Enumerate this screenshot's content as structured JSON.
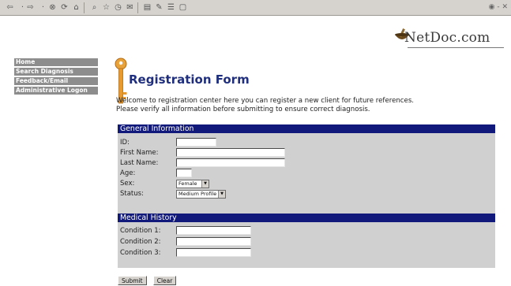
{
  "toolbar": {
    "buttons": [
      "back-icon",
      "forward-icon",
      "stop-icon",
      "refresh-icon",
      "home-icon",
      "search-icon",
      "favorites-icon",
      "history-icon",
      "mail-icon",
      "print-icon",
      "edit-icon",
      "discuss-icon",
      "messenger-icon"
    ]
  },
  "logo": {
    "text": "NetDoc.com"
  },
  "sidebar": {
    "items": [
      {
        "label": "Home"
      },
      {
        "label": "Search Diagnosis"
      },
      {
        "label": "Feedback/Email"
      },
      {
        "label": "Administrative Logon"
      }
    ]
  },
  "page": {
    "title": "Registration Form",
    "intro_line1": "Welcome to registration center here you can register a new client for future references.",
    "intro_line2": "Please verify all information  before submitting to ensure correct diagnosis."
  },
  "general": {
    "header": "General Information",
    "id_label": "ID:",
    "first_name_label": "First Name:",
    "last_name_label": "Last Name:",
    "age_label": "Age:",
    "sex_label": "Sex:",
    "sex_value": "Female",
    "status_label": "Status:",
    "status_value": "Medium Profile"
  },
  "medical": {
    "header": "Medical History",
    "condition1_label": "Condition 1:",
    "condition2_label": "Condition 2:",
    "condition3_label": "Condition 3:"
  },
  "actions": {
    "submit_label": "Submit",
    "clear_label": "Clear"
  },
  "colors": {
    "section_header": "#111a7a",
    "title": "#1f2f7e",
    "section_body": "#d0d0d0",
    "sidebar": "#8d8d8d"
  }
}
